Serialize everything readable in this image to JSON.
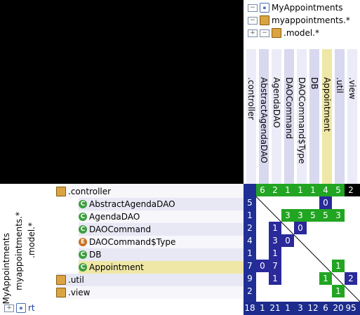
{
  "top_tree": {
    "root_label": "MyAppointments",
    "package_label": "myappointments.*",
    "model_label": ".model.*",
    "dot_label": "."
  },
  "columns": [
    {
      "label": ".controller"
    },
    {
      "label": "AbstractAgendaDAO"
    },
    {
      "label": "AgendaDAO"
    },
    {
      "label": "DAOCommand"
    },
    {
      "label": "DAOCommand$Type"
    },
    {
      "label": "DB"
    },
    {
      "label": "Appointment"
    },
    {
      "label": ".util"
    },
    {
      "label": ".view"
    }
  ],
  "rows": [
    {
      "label": ".controller"
    },
    {
      "label": "AbstractAgendaDAO"
    },
    {
      "label": "AgendaDAO"
    },
    {
      "label": "DAOCommand"
    },
    {
      "label": "DAOCommand$Type"
    },
    {
      "label": "DB"
    },
    {
      "label": "Appointment"
    },
    {
      "label": ".util"
    },
    {
      "label": ".view"
    }
  ],
  "side_labels": {
    "root": "MyAppointments",
    "package": "myappointments.*",
    "model": ".model.*",
    "dot": "."
  },
  "bottom_label": "rt",
  "header_values": [
    "6",
    "2",
    "1",
    "1",
    "1",
    "4",
    "5",
    "2"
  ],
  "row_values": [
    "5",
    "1",
    "2",
    "4",
    "1",
    "7",
    "9",
    "2"
  ],
  "footer_values": [
    "18",
    "1",
    "21",
    "1",
    "3",
    "12",
    "6",
    "20",
    "95"
  ],
  "matrix_cells": [
    {
      "r": 1,
      "c": 6,
      "v": "0"
    },
    {
      "r": 2,
      "c": 3,
      "v": "3"
    },
    {
      "r": 2,
      "c": 4,
      "v": "3"
    },
    {
      "r": 2,
      "c": 5,
      "v": "5"
    },
    {
      "r": 2,
      "c": 6,
      "v": "5"
    },
    {
      "r": 2,
      "c": 7,
      "v": "3"
    },
    {
      "r": 3,
      "c": 2,
      "v": "1"
    },
    {
      "r": 3,
      "c": 4,
      "v": "0"
    },
    {
      "r": 4,
      "c": 2,
      "v": "3"
    },
    {
      "r": 4,
      "c": 3,
      "v": "0"
    },
    {
      "r": 5,
      "c": 2,
      "v": "1"
    },
    {
      "r": 6,
      "c": 1,
      "v": "0"
    },
    {
      "r": 6,
      "c": 2,
      "v": "7"
    },
    {
      "r": 6,
      "c": 7,
      "v": "1"
    },
    {
      "r": 7,
      "c": 2,
      "v": "1"
    },
    {
      "r": 7,
      "c": 6,
      "v": "1"
    },
    {
      "r": 7,
      "c": 8,
      "v": "2"
    },
    {
      "r": 8,
      "c": 7,
      "v": "1"
    }
  ],
  "colors": {
    "matrix_blue": "#2a2a9a",
    "matrix_green": "#22a522",
    "header_green": "#22a522",
    "highlight_yellow": "#efe7a6",
    "row_header_bg": "#dcdcf0"
  }
}
